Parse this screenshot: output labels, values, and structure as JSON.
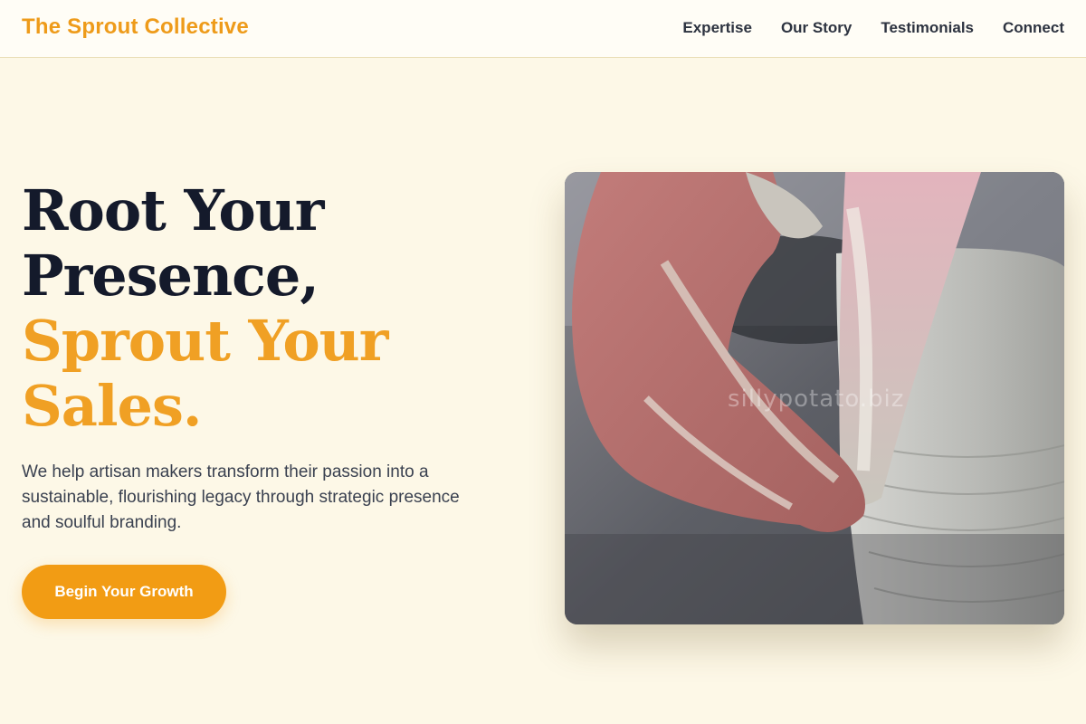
{
  "header": {
    "brand": "The Sprout Collective",
    "nav": [
      "Expertise",
      "Our Story",
      "Testimonials",
      "Connect"
    ]
  },
  "hero": {
    "title_line1": "Root Your",
    "title_line2": "Presence,",
    "title_accent_line1": "Sprout Your",
    "title_accent_line2": "Sales.",
    "subtitle": "We help artisan makers transform their passion into a sustainable, flourishing legacy through strategic presence and soulful branding.",
    "cta_label": "Begin Your Growth"
  },
  "image": {
    "subject": "hands shaping clay on a pottery wheel",
    "watermark": "sillypotato.biz"
  },
  "colors": {
    "accent": "#f29c14",
    "background": "#fdf8e7",
    "heading": "#141a2b"
  }
}
